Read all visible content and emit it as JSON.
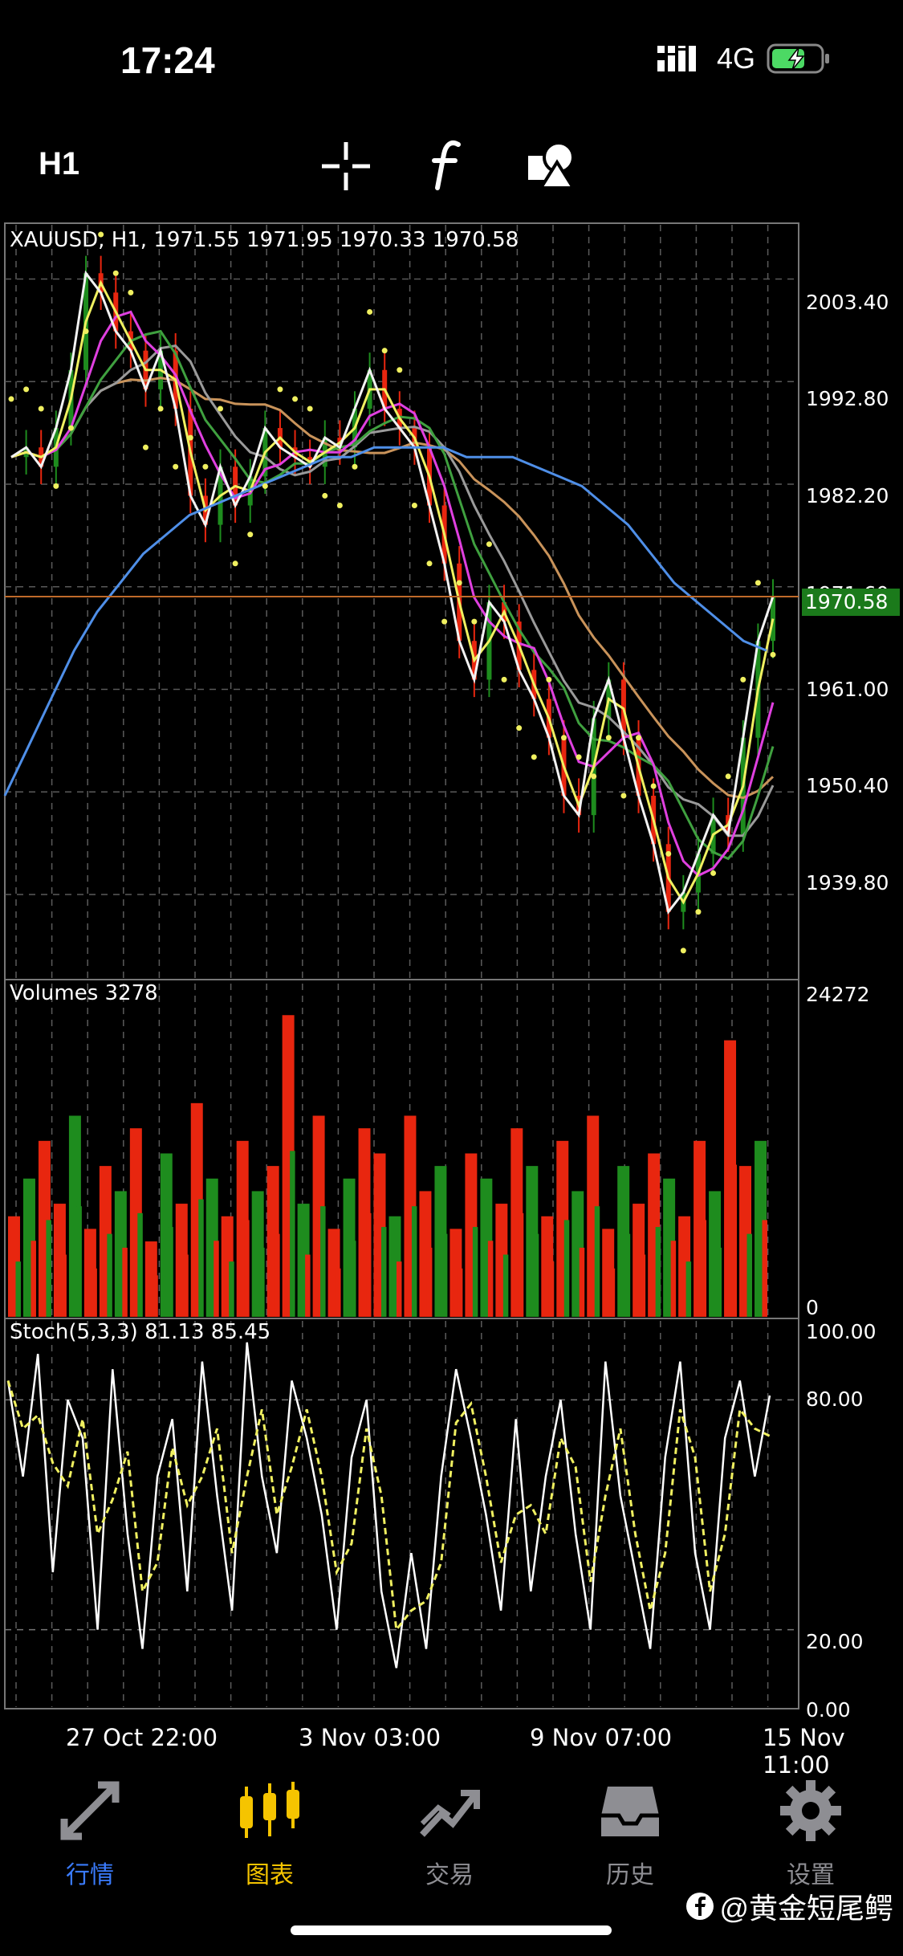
{
  "status": {
    "time": "17:24",
    "network": "4G"
  },
  "toolbar": {
    "timeframe": "H1"
  },
  "chart": {
    "header": "XAUUSD, H1, 1971.55 1971.95 1970.33 1970.58",
    "price_labels": [
      "2003.40",
      "1992.80",
      "1982.20",
      "1971.60",
      "1961.00",
      "1950.40",
      "1939.80"
    ],
    "current_price": "1970.58",
    "volumes_header": "Volumes 3278",
    "volume_max": "24272",
    "volume_min": "0",
    "stoch_header": "Stoch(5,3,3) 81.13 85.45",
    "stoch_labels": [
      "100.00",
      "80.00",
      "20.00",
      "0.00"
    ],
    "x_labels": [
      "27 Oct 22:00",
      "3 Nov 03:00",
      "9 Nov 07:00",
      "15 Nov 11:00"
    ],
    "colors": {
      "bull": "#1e8c1e",
      "bear": "#e8260f",
      "ma_blue": "#4f8fe8",
      "ma_tan": "#c9935a",
      "ma_gray": "#9a9a9a",
      "ma_green": "#3fa03f",
      "ma_magenta": "#e040e0",
      "ma_yellow": "#f0f060",
      "current_line": "#c06a2a"
    }
  },
  "chart_data": [
    {
      "type": "line",
      "title": "XAUUSD, H1, 1971.55 1971.95 1970.33 1970.58",
      "ylim": [
        1931,
        2009
      ],
      "x_ticks": [
        "27 Oct 22:00",
        "3 Nov 03:00",
        "9 Nov 07:00",
        "15 Nov 11:00"
      ],
      "series": [
        {
          "values": [
            1985,
            1986,
            1984,
            1988,
            1994,
            2004,
            2002,
            1998,
            1996,
            1992,
            1996,
            1990,
            1981,
            1978,
            1984,
            1980,
            1983,
            1988,
            1986,
            1985,
            1984,
            1987,
            1986,
            1990,
            1994,
            1990,
            1988,
            1986,
            1980,
            1974,
            1966,
            1962,
            1970,
            1968,
            1963,
            1960,
            1956,
            1950,
            1948,
            1958,
            1962,
            1956,
            1950,
            1945,
            1938,
            1940,
            1944,
            1948,
            1946,
            1956,
            1966,
            1970.58
          ]
        },
        {
          "name": "",
          "values": [
            1950,
            1955,
            1960,
            1965,
            1969,
            1972,
            1975,
            1977,
            1979,
            1980,
            1981,
            1982,
            1983,
            1984,
            1985,
            1985,
            1986,
            1986,
            1986,
            1986,
            1985,
            1985,
            1985,
            1984,
            1983,
            1982,
            1980,
            1978,
            1975,
            1972,
            1970,
            1968,
            1966,
            1965
          ]
        }
      ]
    },
    {
      "type": "bar",
      "title": "Volumes 3278",
      "ylim": [
        0,
        24272
      ],
      "values": [
        8000,
        11000,
        14000,
        9000,
        16000,
        7000,
        12000,
        10000,
        15000,
        6000,
        13000,
        9000,
        17000,
        11000,
        8000,
        14000,
        10000,
        12000,
        24000,
        9000,
        16000,
        7000,
        11000,
        15000,
        13000,
        8000,
        16000,
        10000,
        12000,
        7000,
        13000,
        11000,
        9000,
        15000,
        12000,
        8000,
        14000,
        10000,
        16000,
        7000,
        12000,
        9000,
        13000,
        11000,
        8000,
        14000,
        10000,
        22000,
        12000,
        14000
      ]
    },
    {
      "type": "line",
      "title": "Stoch(5,3,3) 81.13 85.45",
      "ylim": [
        0,
        100
      ],
      "series": [
        {
          "values": [
            85,
            60,
            92,
            35,
            80,
            70,
            20,
            88,
            45,
            15,
            60,
            75,
            30,
            90,
            55,
            25,
            95,
            60,
            40,
            85,
            70,
            50,
            20,
            65,
            80,
            30,
            10,
            40,
            15,
            60,
            88,
            70,
            50,
            25,
            75,
            30,
            60,
            80,
            45,
            20,
            90,
            55,
            35,
            15,
            65,
            90,
            40,
            20,
            70,
            85,
            60,
            81.13
          ]
        }
      ]
    }
  ],
  "tabs": [
    {
      "label": "行情",
      "icon": "quotes-arrows-icon",
      "color": "#3a7bfd"
    },
    {
      "label": "图表",
      "icon": "chart-candles-icon",
      "color": "#f5c400"
    },
    {
      "label": "交易",
      "icon": "trade-chart-icon",
      "color": "#8e8e93"
    },
    {
      "label": "历史",
      "icon": "history-inbox-icon",
      "color": "#8e8e93"
    },
    {
      "label": "设置",
      "icon": "settings-gear-icon",
      "color": "#8e8e93"
    }
  ],
  "watermark": "@黄金短尾鳄"
}
